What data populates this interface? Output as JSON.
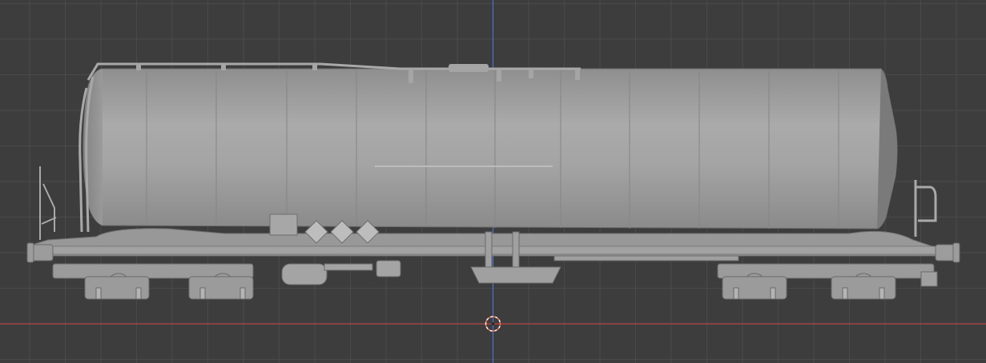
{
  "viewport": {
    "kind": "3d-viewport-orthographic-front",
    "background": "#3d3d3d",
    "grid_color": "#4a4a4a",
    "grid_major_color": "#525252",
    "x_axis_color": "#b84545",
    "z_axis_color": "#4a73c9",
    "cursor_color": "#ff6a4d"
  },
  "model": {
    "name_icon": "tank-wagon-model",
    "body_color": "#9e9e9e",
    "body_light": "#ababab",
    "body_dark": "#7a7a7a",
    "hazard_diamonds": 3
  }
}
